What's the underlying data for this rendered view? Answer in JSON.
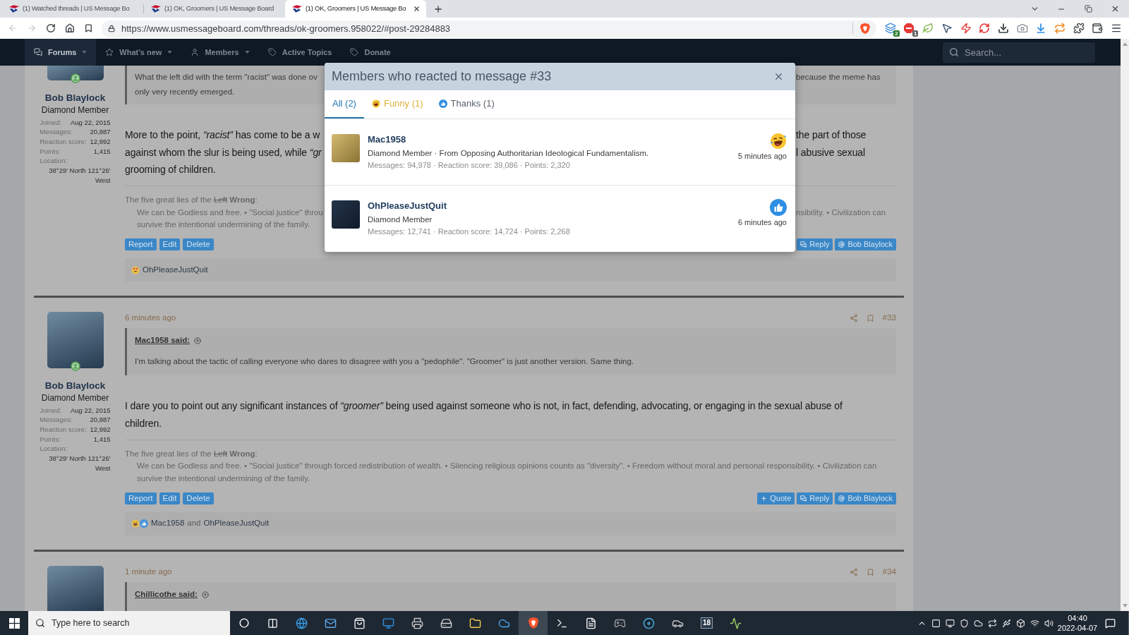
{
  "browser": {
    "tabs": [
      {
        "title": "(1) Watched threads | US Message Bo",
        "selected": false
      },
      {
        "title": "(1) OK, Groomers | US Message Board",
        "selected": false
      },
      {
        "title": "(1) OK, Groomers | US Message Bo",
        "selected": true
      }
    ],
    "back": {
      "disabled": true
    },
    "forward": {
      "disabled": true
    },
    "url": "https://www.usmessageboard.com/threads/ok-groomers.958022/#post-29284883",
    "extension_badges": [
      "2",
      "1"
    ]
  },
  "site_nav": {
    "items": [
      {
        "label": "Forums",
        "selected": true,
        "dropdown": true
      },
      {
        "label": "What's new",
        "selected": false,
        "dropdown": true
      },
      {
        "label": "Members",
        "selected": false,
        "dropdown": true
      },
      {
        "label": "Active Topics",
        "selected": false,
        "dropdown": false
      },
      {
        "label": "Donate",
        "selected": false,
        "dropdown": false
      }
    ],
    "search": {
      "placeholder": "Search..."
    }
  },
  "posts": [
    {
      "author": {
        "name": "Bob Blaylock",
        "title": "Diamond Member",
        "online": true,
        "stats": [
          {
            "label": "Joined:",
            "value": "Aug 22, 2015"
          },
          {
            "label": "Messages:",
            "value": "20,887"
          },
          {
            "label": "Reaction score:",
            "value": "12,992"
          },
          {
            "label": "Points:",
            "value": "1,415"
          }
        ],
        "location_label": "Location:",
        "location": "38°29′ North 121°26′ West"
      },
      "quote": {
        "lines": [
          {
            "left": "What the left did with the term \"racist\" was done ov",
            "right": "because the meme has"
          },
          {
            "left": "only very recently emerged."
          }
        ]
      },
      "body_lines": [
        {
          "left": "More to the point, *“racist”* has come to be a w",
          "right": "the part of those"
        },
        {
          "left": "against whom the slur is being used, while *“gr*",
          "right": "l abusive sexual"
        },
        {
          "left": "grooming of children."
        }
      ],
      "signature": {
        "heading": [
          {
            "text": "The five great lies of the",
            "struck": false
          },
          {
            "text": "Left",
            "struck": true
          },
          {
            "text": "**Wrong**:",
            "struck": false
          }
        ],
        "lines": [
          {
            "left": "We can be Godless and free. • \"Social justice\" throu",
            "right": "nsibility. • Civilization can"
          },
          {
            "left": "survive the intentional undermining of the family."
          }
        ]
      },
      "actions_left": [
        "Report",
        "Edit",
        "Delete"
      ],
      "actions_right": [
        {
          "kind": "reply",
          "label": "Reply"
        },
        {
          "kind": "mention",
          "label": "Bob Blaylock"
        }
      ],
      "reactions": {
        "icons": [
          {
            "kind": "love"
          }
        ],
        "users": [
          "OhPleaseJustQuit"
        ]
      }
    },
    {
      "author": {
        "name": "Bob Blaylock",
        "title": "Diamond Member",
        "online": true,
        "stats": [
          {
            "label": "Joined:",
            "value": "Aug 22, 2015"
          },
          {
            "label": "Messages:",
            "value": "20,887"
          },
          {
            "label": "Reaction score:",
            "value": "12,992"
          },
          {
            "label": "Points:",
            "value": "1,415"
          }
        ],
        "location_label": "Location:",
        "location": "38°29′ North 121°26′ West"
      },
      "time": "6 minutes ago",
      "number": "#33",
      "quote": {
        "author": "Mac1958 said:",
        "text": "I'm talking about the tactic of calling everyone who dares to disagree with you a \"pedophile\". \"Groomer\" is just another version. Same thing."
      },
      "body": "I dare you to point out any significant instances of *“groomer”* being used against someone who is not, in fact, defending, advocating, or engaging in the sexual abuse of children.",
      "signature": {
        "heading": [
          {
            "text": "The five great lies of the",
            "struck": false
          },
          {
            "text": "Left",
            "struck": true
          },
          {
            "text": "**Wrong**:",
            "struck": false
          }
        ],
        "text": "We can be Godless and free. • \"Social justice\" through forced redistribution of wealth. • Silencing religious opinions counts as \"diversity\". • Freedom without moral and personal responsibility. • Civilization can survive the intentional undermining of the family."
      },
      "actions_left": [
        "Report",
        "Edit",
        "Delete"
      ],
      "actions_right": [
        {
          "kind": "quote",
          "label": "Quote"
        },
        {
          "kind": "reply",
          "label": "Reply"
        },
        {
          "kind": "mention",
          "label": "Bob Blaylock"
        }
      ],
      "reactions": {
        "icons": [
          {
            "kind": "haha"
          },
          {
            "kind": "like"
          }
        ],
        "users": [
          "Mac1958",
          "OhPleaseJustQuit"
        ],
        "joiner": "and"
      }
    },
    {
      "time": "1 minute ago",
      "number": "#34",
      "quote": {
        "author": "Chillicothe said:"
      }
    }
  ],
  "reactions_dialog": {
    "title": "Members who reacted to message #33",
    "tabs": [
      {
        "label": "All (2)",
        "selected": true
      },
      {
        "label": "Funny (1)",
        "selected": false,
        "kind": "haha",
        "color": "#dfb13c"
      },
      {
        "label": "Thanks (1)",
        "selected": false,
        "kind": "like"
      }
    ],
    "members": [
      {
        "name": "Mac1958",
        "subtitle": "Diamond Member · From Opposing Authoritarian Ideological Fundamentalism.",
        "stats": "Messages: 94,978 · Reaction score: 39,086 · Points: 2,320",
        "reaction": {
          "kind": "haha"
        },
        "time": "5 minutes ago"
      },
      {
        "name": "OhPleaseJustQuit",
        "subtitle": "Diamond Member",
        "stats": "Messages: 12,741 · Reaction score: 14,724 · Points: 2,268",
        "reaction": {
          "kind": "like"
        },
        "time": "6 minutes ago"
      }
    ]
  },
  "taskbar": {
    "search": {
      "placeholder": "Type here to search"
    },
    "apps": [
      {
        "selected": false
      },
      {
        "selected": false
      },
      {
        "selected": false
      },
      {
        "selected": false
      },
      {
        "selected": false
      },
      {
        "selected": false
      },
      {
        "selected": false
      },
      {
        "selected": false
      },
      {
        "selected": true
      },
      {
        "selected": false
      },
      {
        "selected": false
      },
      {
        "selected": false
      },
      {
        "selected": false
      },
      {
        "selected": false
      },
      {
        "selected": false,
        "label": "18"
      },
      {
        "selected": false
      }
    ],
    "clock": {
      "time": "04:40",
      "date": "2022-04-07"
    }
  }
}
